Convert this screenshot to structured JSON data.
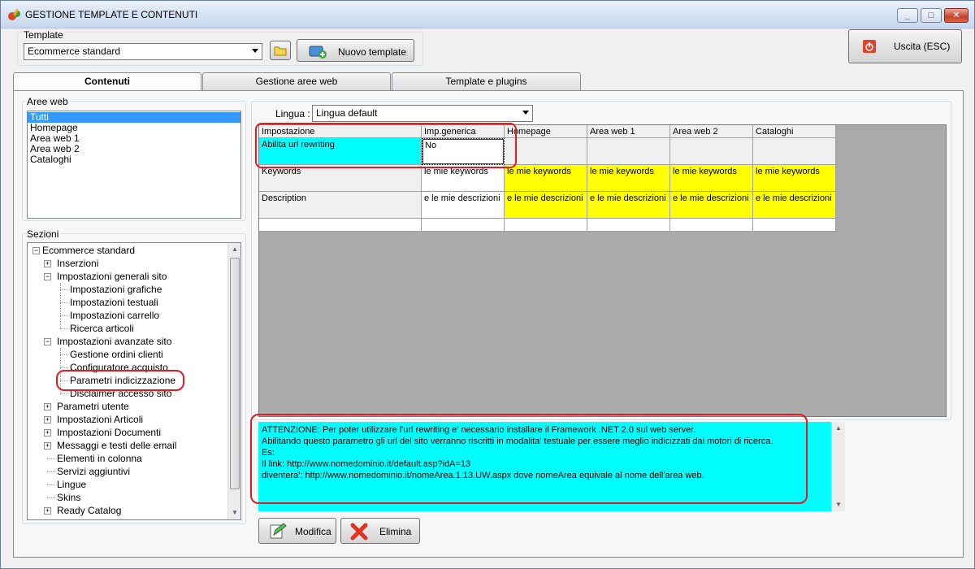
{
  "window": {
    "title": "GESTIONE TEMPLATE E CONTENUTI",
    "btn_min": "_",
    "btn_max": "□",
    "btn_close": "✕"
  },
  "template": {
    "label": "Template",
    "selected": "Ecommerce standard",
    "new_button": "Nuovo template"
  },
  "exit_button": "Uscita (ESC)",
  "tabs": [
    {
      "label": "Contenuti"
    },
    {
      "label": "Gestione aree web"
    },
    {
      "label": "Template e plugins"
    }
  ],
  "aree_web": {
    "label": "Aree web",
    "items": [
      "Tutti",
      "Homepage",
      "Area web 1",
      "Area web 2",
      "Cataloghi"
    ],
    "selected_index": 0
  },
  "sezioni": {
    "label": "Sezioni",
    "items": [
      {
        "text": "Ecommerce standard",
        "level": 0,
        "exp": "−"
      },
      {
        "text": "Inserzioni",
        "level": 1,
        "exp": "+"
      },
      {
        "text": "Impostazioni generali sito",
        "level": 1,
        "exp": "−"
      },
      {
        "text": "Impostazioni grafiche",
        "level": 2,
        "exp": ""
      },
      {
        "text": "Impostazioni testuali",
        "level": 2,
        "exp": ""
      },
      {
        "text": "Impostazioni carrello",
        "level": 2,
        "exp": ""
      },
      {
        "text": "Ricerca articoli",
        "level": 2,
        "exp": ""
      },
      {
        "text": "Impostazioni avanzate sito",
        "level": 1,
        "exp": "−"
      },
      {
        "text": "Gestione ordini clienti",
        "level": 2,
        "exp": ""
      },
      {
        "text": "Configuratore acquisto",
        "level": 2,
        "exp": ""
      },
      {
        "text": "Parametri indicizzazione",
        "level": 2,
        "exp": ""
      },
      {
        "text": "Disclaimer accesso sito",
        "level": 2,
        "exp": ""
      },
      {
        "text": "Parametri utente",
        "level": 1,
        "exp": "+"
      },
      {
        "text": "Impostazioni Articoli",
        "level": 1,
        "exp": "+"
      },
      {
        "text": "Impostazioni Documenti",
        "level": 1,
        "exp": "+"
      },
      {
        "text": "Messaggi e testi delle email",
        "level": 1,
        "exp": "+"
      },
      {
        "text": "Elementi in colonna",
        "level": 1,
        "exp": ""
      },
      {
        "text": "Servizi aggiuntivi",
        "level": 1,
        "exp": ""
      },
      {
        "text": "Lingue",
        "level": 1,
        "exp": ""
      },
      {
        "text": "Skins",
        "level": 1,
        "exp": ""
      },
      {
        "text": "Ready Catalog",
        "level": 1,
        "exp": "+"
      }
    ]
  },
  "lingua": {
    "label": "Lingua :",
    "selected": "Lingua default"
  },
  "grid": {
    "columns": [
      "Impostazione",
      "Imp.generica",
      "Homepage",
      "Area web 1",
      "Area web 2",
      "Cataloghi"
    ],
    "rows": [
      [
        "Abilita url rewriting",
        "No",
        "",
        "",
        "",
        ""
      ],
      [
        "Keywords",
        "le mie keywords",
        "le mie keywords",
        "le mie keywords",
        "le mie keywords",
        "le mie keywords"
      ],
      [
        "Description",
        "e le mie descrizioni",
        "e le mie descrizioni",
        "e le mie descrizioni",
        "e le mie descrizioni",
        "e le mie descrizioni"
      ],
      [
        "",
        "",
        "",
        "",
        "",
        ""
      ]
    ]
  },
  "message": {
    "lines": [
      "ATTENZIONE: Per poter utilizzare l'url rewriting e' necessario installare il Framework .NET 2.0 sul web server.",
      "Abilitando questo parametro gli url del sito verranno riscritti in modalita' testuale per essere meglio indicizzati dai motori di ricerca.",
      "Es:",
      "Il link: http://www.nomedominio.it/default.asp?idA=13",
      "diventera': http://www.nomedominio.it/nomeArea.1.13.UW.aspx dove nomeArea equivale al nome dell'area web."
    ]
  },
  "buttons": {
    "modifica": "Modifica",
    "elimina": "Elimina"
  },
  "colors": {
    "cyan": "#00ffff",
    "yellow": "#ffff00",
    "highlight": "#e01b24",
    "selection": "#3399ff"
  }
}
